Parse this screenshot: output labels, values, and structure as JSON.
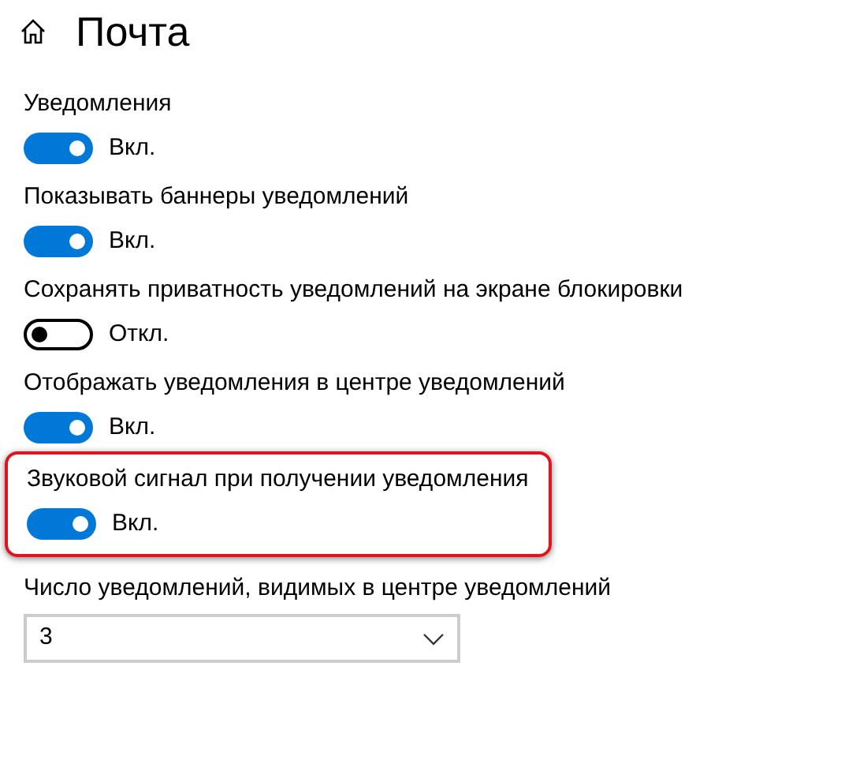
{
  "header": {
    "title": "Почта"
  },
  "toggles": [
    {
      "label": "Уведомления",
      "on": true,
      "state_text": "Вкл.",
      "highlighted": false
    },
    {
      "label": "Показывать баннеры уведомлений",
      "on": true,
      "state_text": "Вкл.",
      "highlighted": false
    },
    {
      "label": "Сохранять приватность уведомлений на экране блокировки",
      "on": false,
      "state_text": "Откл.",
      "highlighted": false
    },
    {
      "label": "Отображать уведомления в центре уведомлений",
      "on": true,
      "state_text": "Вкл.",
      "highlighted": false
    },
    {
      "label": "Звуковой сигнал при получении уведомления",
      "on": true,
      "state_text": "Вкл.",
      "highlighted": true
    }
  ],
  "dropdown": {
    "label": "Число уведомлений, видимых в центре уведомлений",
    "value": "3"
  }
}
